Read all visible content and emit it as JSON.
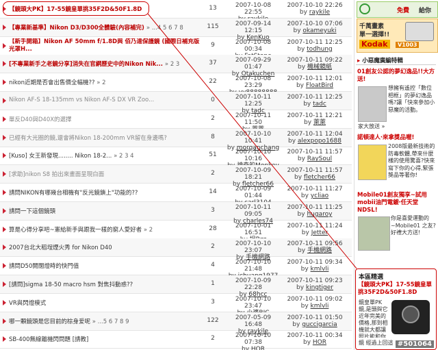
{
  "threads": [
    {
      "title": "【鏡頭大PK】17-55鏡皇單挑35F2D&50F1.8D",
      "pages": "",
      "count": "13",
      "created": "2007-10-08 22:55",
      "author": "raykile",
      "updated": "2007-10-10 22:26",
      "updater": "raykile",
      "style": "red"
    },
    {
      "title": "【專業新基準】Nikon D3/D300全體驗(內容補完)",
      "pages": "» ...4 5 6 7 8",
      "count": "115",
      "created": "2007-09-14 12:15",
      "author": "KenKuo",
      "updated": "2007-10-10 07:06",
      "updater": "okameyuki",
      "style": "red"
    },
    {
      "title": "【新手開箱】Nikon AF 50mm f/1.8D與 佰乃達保護鏡 (國際日補充版光罩H...",
      "pages": "",
      "count": "9",
      "created": "2007-10-08 00:34",
      "author": "FatStone",
      "updated": "2007-10-11 12:25",
      "updater": "todhung",
      "style": "red-wrap"
    },
    {
      "title": "[不專業新手之老鏡分享]消失在官網歷史中的Nikon Nik...",
      "pages": "» 2 3",
      "count": "37",
      "created": "2007-09-29 01:47",
      "author": "Otakuchen",
      "updated": "2007-10-11 09:22",
      "updater": "機械鏡紙",
      "style": "red"
    },
    {
      "title": "nikon近期是否會出售價全幅機??",
      "pages": "» 2",
      "count": "22",
      "created": "2007-10-08 23:29",
      "author": "yy88888888",
      "updated": "2007-10-11 12:01",
      "updater": "FloatBird",
      "style": ""
    },
    {
      "title": "Nikon AF-S 18-135mm vs Nikon AF-S DX VR Zoo...",
      "pages": "",
      "count": "0",
      "created": "2007-10-11 12:25",
      "author": "tadc",
      "updated": "2007-10-11 12:25",
      "updater": "tadc",
      "style": "grey"
    },
    {
      "title": "單反D40與D40X的選擇",
      "pages": "",
      "count": "2",
      "created": "2007-10-11 11:50",
      "author": "萊萊",
      "updated": "2007-10-11 12:21",
      "updater": "萊萊",
      "style": "grey"
    },
    {
      "title": "已經有大光圈的鏡,還會將Nikon 18-200mm VR留在身邊嗎?",
      "pages": "",
      "count": "8",
      "created": "2007-10-10 10:41",
      "author": "morganchang",
      "updated": "2007-10-11 12:04",
      "updater": "alexpopo1688",
      "style": "grey"
    },
    {
      "title": "[Kuso] 女王新發現........ Nikon 18-2...",
      "pages": "» 2 3 4",
      "count": "51",
      "created": "2007-10-10 10:16",
      "author": "神奇的Monkey",
      "updated": "2007-10-11 11:57",
      "updater": "RaySoul",
      "style": ""
    },
    {
      "title": "[求助]nikon S8 拍出來畫面呈現白面",
      "pages": "",
      "count": "2",
      "created": "2007-10-09 18:21",
      "author": "fletcher66",
      "updated": "2007-10-11 11:57",
      "updater": "fletcher66",
      "style": "grey"
    },
    {
      "title": "請問NIKON有哪幾台相機有\"反光鏡鎖上\"功能的??",
      "pages": "",
      "count": "14",
      "created": "2007-10-09 01:44",
      "author": "carl3104",
      "updated": "2007-10-11 11:27",
      "updater": "ycliao",
      "style": ""
    },
    {
      "title": "請問一下這個鏡頭",
      "pages": "",
      "count": "3",
      "created": "2007-10-11 09:05",
      "author": "charles74",
      "updated": "2007-10-11 11:25",
      "updater": "hugaroy",
      "style": ""
    },
    {
      "title": "算是心得分享吧~憲給新手與跟我一樣的窮人愛好者",
      "pages": "» 2",
      "count": "28",
      "created": "2007-10-01 16:51",
      "author": "坦Bzz",
      "updated": "2007-10-11 11:24",
      "updater": "Jetter",
      "style": ""
    },
    {
      "title": "2007台北大稻埕煙火秀 for Nikon D40",
      "pages": "",
      "count": "2",
      "created": "2007-10-10 23:07",
      "author": "手機網路",
      "updated": "2007-10-11 09:56",
      "updater": "手機網路",
      "style": ""
    },
    {
      "title": "請問D50開闊燈時的快門值",
      "pages": "",
      "count": "4",
      "created": "2007-10-10 21:48",
      "author": "jchuang1977",
      "updated": "2007-10-11 09:34",
      "updater": "kmlvli",
      "style": ""
    },
    {
      "title": "[請問]sigma 18-50 macro hsm 對焦抖動惑??",
      "pages": "",
      "count": "1",
      "created": "2007-10-09 22:28",
      "author": "68hcc",
      "updated": "2007-10-11 09:23",
      "updater": "kingtiger",
      "style": ""
    },
    {
      "title": "VR與閃燈模式",
      "pages": "",
      "count": "3",
      "created": "2007-10-10 23:47",
      "author": "小婆BIC",
      "updated": "2007-10-11 09:02",
      "updater": "kmlvli",
      "style": ""
    },
    {
      "title": "哪一顆鏡頭是您目前的棕身爱呢",
      "pages": "» ...5 6 7 8 9",
      "count": "122",
      "created": "2007-05-09 16:48",
      "author": "raykile",
      "updated": "2007-10-11 01:50",
      "updater": "guccigarcia",
      "style": ""
    },
    {
      "title": "SB-400無線離機閃問題 [請教]",
      "pages": "",
      "count": "2",
      "created": "2007-10-10 07:38",
      "author": "HOR",
      "updated": "2007-10-11 00:34",
      "updater": "HOR",
      "style": ""
    }
  ],
  "sidebar": {
    "top_banner": {
      "text": "免費",
      "text2": "給你"
    },
    "kodak": {
      "line1": "千萬畫素",
      "line2": "單一選擇!!",
      "brand": "Kodak",
      "model": "V1003"
    },
    "section_header": "小惡魔廣編特輯",
    "items": [
      {
        "title": "01創友公認的夢幻逸品!!大方送!",
        "body": "想擁有遙控「數位相框」的夢幻逸品嗎?讓「快來參加小惡魔的活動。",
        "footer": "家大放送 »"
      },
      {
        "title": "諾頓達人‧來拿獎品喔!",
        "body": "2008版最新技術的防毒軟體,帶來什麼樣的使用驚喜?快來寫下你的心得,緊張獎品等著你!",
        "footer": ""
      },
      {
        "title": "Mobile01創友獨享~試用mobii油門電鍍‧任天堂NDSL!",
        "body": "你是喜愛運動的~Mobile01 之友? 好禮大方送!",
        "footer": ""
      }
    ],
    "promo": {
      "header": "本區精選",
      "title": "【鏡頭大PK】17-55鏡皇單挑35F2D&50F1.8D",
      "body": "鏡皇單PK鏡,是頭與它近年完美的價格,那到相機就大都讓照片能和你交流的",
      "footer": "鏡 經過上回這 »"
    }
  },
  "watermark": "#501064",
  "colors": {
    "accent": "#cc0000",
    "link": "#333333"
  }
}
